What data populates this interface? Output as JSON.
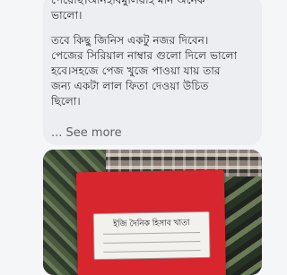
{
  "review": {
    "lines": [
      "পেয়েছি।অনিহাবমুলিয়াই মান অনেক",
      "ভালো।",
      "",
      "তবে কিছু জিনিস একটু নজর দিবেন।",
      "পেজের সিরিয়াল নাম্বার গুলো দিলে ভালো",
      "হবে।সহজে পেজ খুজে পাওয়া যায় তার",
      "জন্য একটা লাল ফিতা দেওয়া উচিত",
      "ছিলো।"
    ],
    "see_more": "... See more"
  },
  "photo": {
    "label_title": "ইজি দৈনিক হিসাব খাতা"
  }
}
